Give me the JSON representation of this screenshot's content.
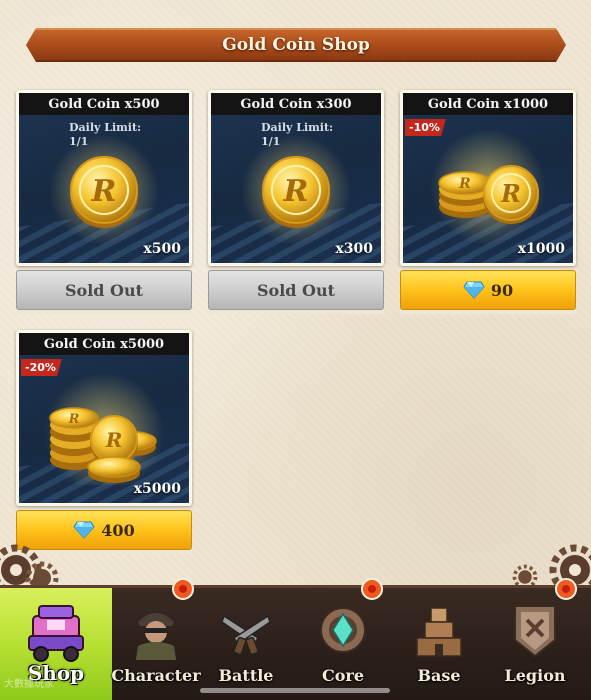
{
  "shop": {
    "title": "Gold Coin Shop"
  },
  "items": [
    {
      "name": "Gold Coin x500",
      "limit_label": "Daily Limit:",
      "limit_value": "1/1",
      "quantity": "x500",
      "button": "Sold Out"
    },
    {
      "name": "Gold Coin x300",
      "limit_label": "Daily Limit:",
      "limit_value": "1/1",
      "quantity": "x300",
      "button": "Sold Out"
    },
    {
      "name": "Gold Coin x1000",
      "discount": "-10%",
      "quantity": "x1000",
      "price": "90",
      "icon": "diamond-gem-icon"
    },
    {
      "name": "Gold Coin x5000",
      "discount": "-20%",
      "quantity": "x5000",
      "price": "400",
      "icon": "diamond-gem-icon"
    }
  ],
  "nav": {
    "tabs": [
      {
        "label": "Shop",
        "icon": "shop-cart-icon",
        "active": true
      },
      {
        "label": "Character",
        "icon": "soldier-portrait-icon",
        "badge": true
      },
      {
        "label": "Battle",
        "icon": "crossed-pistols-icon"
      },
      {
        "label": "Core",
        "icon": "core-crystal-icon",
        "badge": true
      },
      {
        "label": "Base",
        "icon": "base-tower-icon"
      },
      {
        "label": "Legion",
        "icon": "legion-emblem-icon",
        "badge": true
      }
    ]
  },
  "watermark": "大數據玩家",
  "colors": {
    "accent_orange": "#b5501e",
    "buy_yellow": "#ffc21a",
    "sold_grey": "#c9c9c9",
    "nav_active": "#b6e032",
    "discount_red": "#c4281c"
  }
}
